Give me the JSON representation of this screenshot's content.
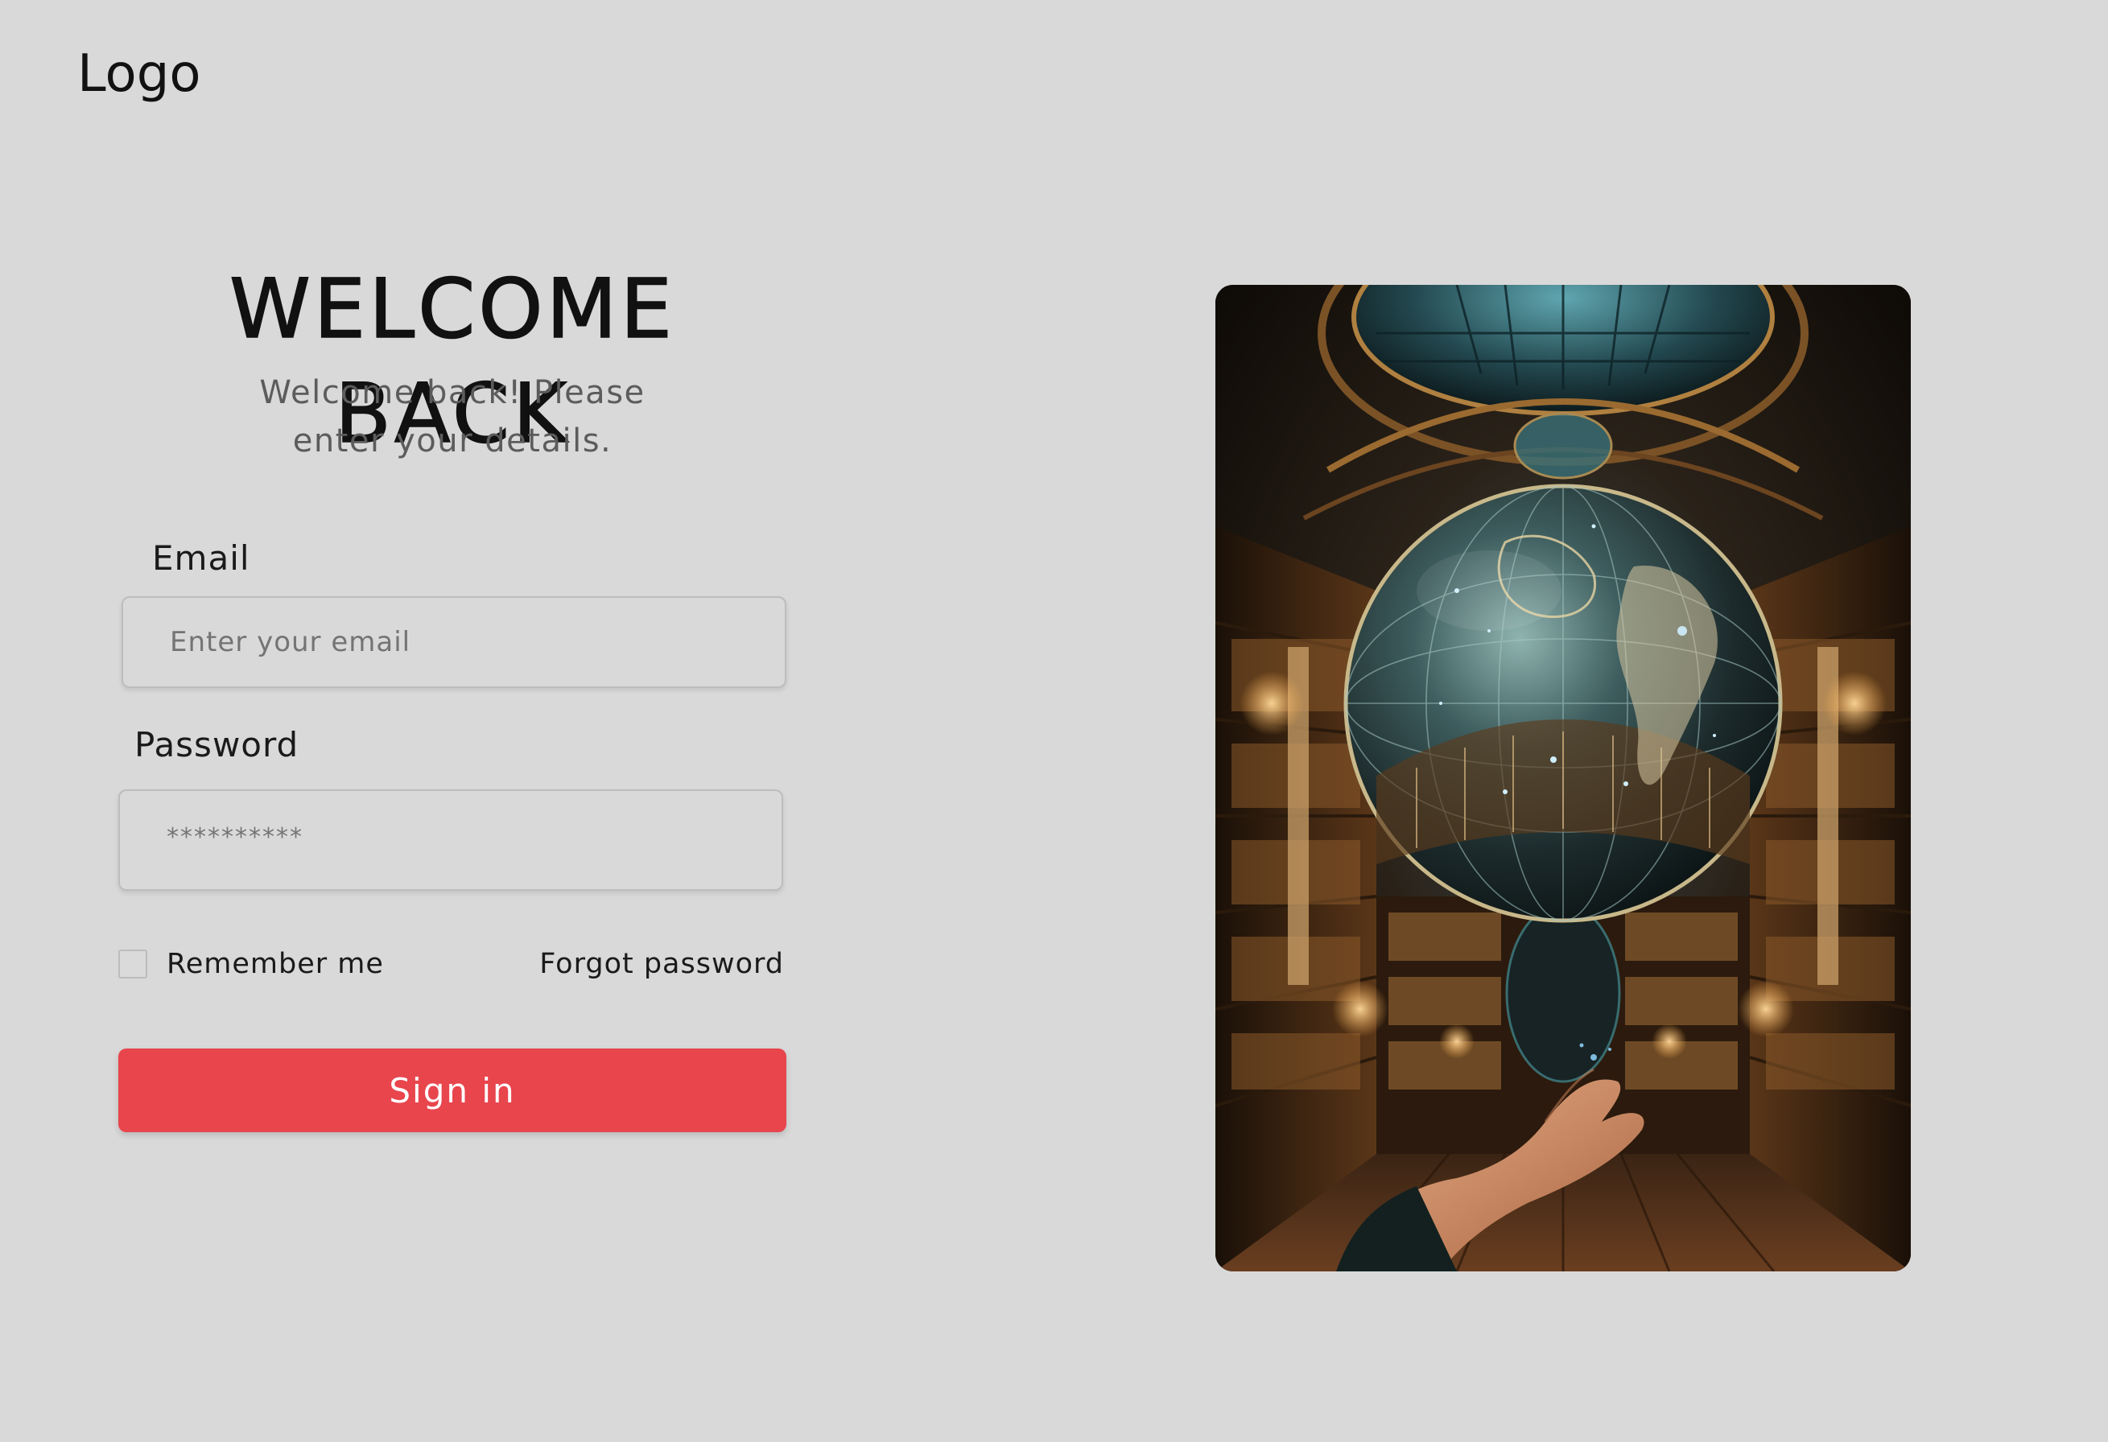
{
  "header": {
    "logo_text": "Logo"
  },
  "login": {
    "title": "WELCOME BACK",
    "subtitle_line1": "Welcome back! Please",
    "subtitle_line2": "enter your details.",
    "email_label": "Email",
    "email_placeholder": "Enter your email",
    "password_label": "Password",
    "password_value": "**********",
    "remember_label": "Remember me",
    "remember_checked": false,
    "forgot_label": "Forgot password",
    "signin_label": "Sign in"
  },
  "colors": {
    "background": "#d9d9d9",
    "primary_button": "#e8454d",
    "text": "#111111",
    "muted_text": "#5c5c5c"
  },
  "hero": {
    "icon": "library-globe-hand-image"
  }
}
